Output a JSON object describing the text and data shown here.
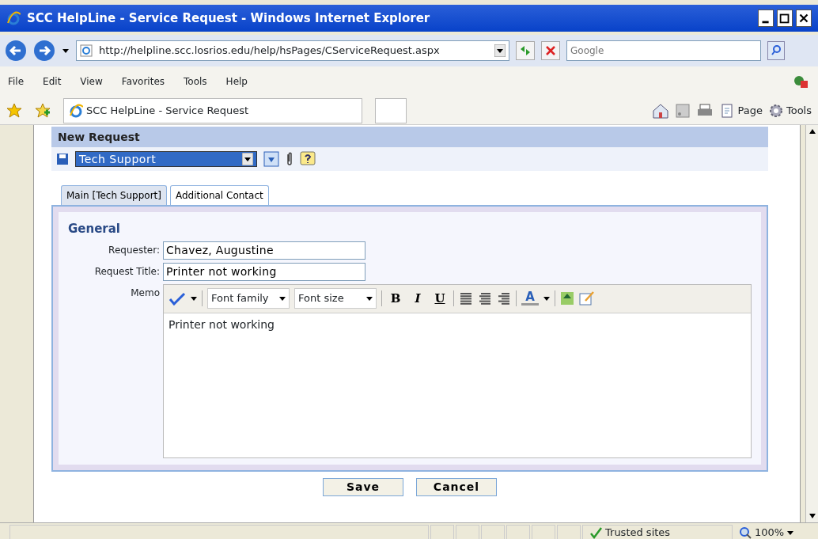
{
  "window": {
    "title": "SCC HelpLine - Service Request - Windows Internet Explorer"
  },
  "address_bar": {
    "url": "http://helpline.scc.losrios.edu/help/hsPages/CServiceRequest.aspx"
  },
  "search": {
    "placeholder": "Google"
  },
  "menu": [
    "File",
    "Edit",
    "View",
    "Favorites",
    "Tools",
    "Help"
  ],
  "browser_tab": {
    "title": "SCC HelpLine - Service Request"
  },
  "command_bar": [
    "Page",
    "Tools"
  ],
  "page": {
    "heading": "New Request",
    "category": "Tech Support",
    "tabs": [
      {
        "label": "Main [Tech Support]",
        "selected": true
      },
      {
        "label": "Additional Contact",
        "selected": false
      }
    ],
    "section": "General",
    "fields": [
      {
        "label": "Requester:",
        "value": "Chavez, Augustine"
      },
      {
        "label": "Request Title:",
        "value": "Printer not working"
      }
    ],
    "memo": {
      "label": "Memo",
      "font_family": "Font family",
      "font_size": "Font size",
      "format_buttons": [
        "B",
        "I",
        "U"
      ],
      "color_button": "A",
      "content": "Printer not working"
    },
    "buttons": [
      "Save",
      "Cancel"
    ]
  },
  "status_bar": {
    "zone": "Trusted sites",
    "zoom": "100%"
  }
}
